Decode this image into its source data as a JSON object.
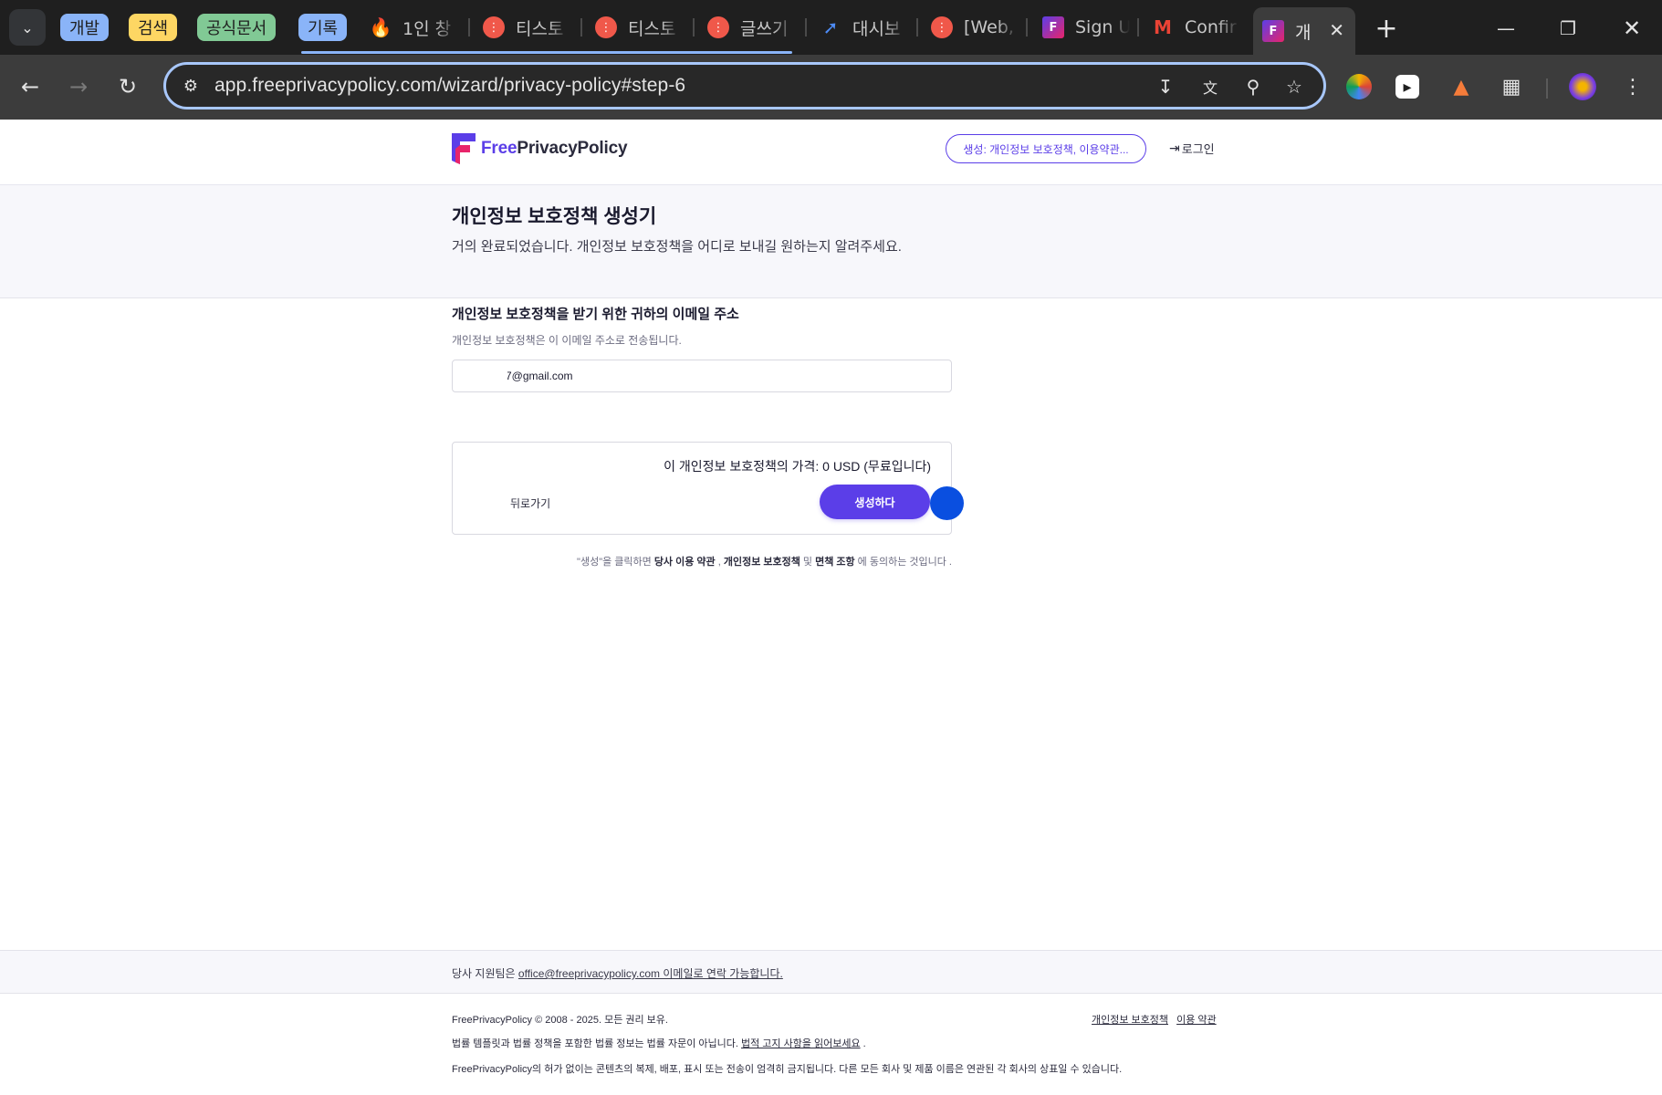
{
  "browser": {
    "tab_groups": [
      {
        "label": "개발",
        "color": "#8ab4f8"
      },
      {
        "label": "검색",
        "color": "#fdd663"
      },
      {
        "label": "공식문서",
        "color": "#81c995"
      },
      {
        "label": "기록",
        "color": "#8ab4f8"
      }
    ],
    "tabs": [
      {
        "label": "1인 창",
        "icon": "fire-icon"
      },
      {
        "label": "티스토",
        "icon": "tistory-icon"
      },
      {
        "label": "티스토",
        "icon": "tistory-icon"
      },
      {
        "label": "글쓰기",
        "icon": "tistory-icon"
      },
      {
        "label": "대시보",
        "icon": "dashboard-icon"
      },
      {
        "label": "[Web,",
        "icon": "tistory-icon"
      },
      {
        "label": "Sign U",
        "icon": "freeprivacypolicy-icon"
      },
      {
        "label": "Confir",
        "icon": "gmail-icon"
      }
    ],
    "active_tab": {
      "label": "개",
      "icon": "freeprivacypolicy-icon"
    },
    "url": "app.freeprivacypolicy.com/wizard/privacy-policy#step-6",
    "accent": "#a8c7fa"
  },
  "site": {
    "logo_free": "Free",
    "logo_rest": "PrivacyPolicy",
    "header_pill": "생성: 개인정보 보호정책, 이용약관...",
    "login": "로그인",
    "brand_color": "#5b3ee8"
  },
  "hero": {
    "title": "개인정보 보호정책 생성기",
    "subtitle": "거의 완료되었습니다. 개인정보 보호정책을 어디로 보내길 원하는지 알려주세요."
  },
  "form": {
    "email_label": "개인정보 보호정책을 받기 위한 귀하의 이메일 주소",
    "email_help": "개인정보 보호정책은 이 이메일 주소로 전송됩니다.",
    "email_value": "7@gmail.com"
  },
  "price": {
    "text": "이 개인정보 보호정책의 가격: 0 USD (무료입니다)",
    "back": "뒤로가기",
    "generate": "생성하다"
  },
  "terms": {
    "prefix": "\"생성\"을 클릭하면 ",
    "tos": "당사 이용 약관",
    "comma": " , ",
    "privacy": "개인정보 보호정책",
    "and": " 및 ",
    "disclaimer": "면책 조항",
    "suffix": " 에 동의하는 것입니다 ."
  },
  "support": {
    "prefix": "당사 지원팀은 ",
    "link": "office@freeprivacypolicy.com 이메일로 연락 가능합니다."
  },
  "footer": {
    "copyright": "FreePrivacyPolicy © 2008 - 2025. 모든 권리 보유.",
    "link_privacy": "개인정보 보호정책",
    "link_terms": "이용 약관",
    "legal_prefix": "법률 템플릿과 법률 정책을 포함한 법률 정보는 법률 자문이 아닙니다. ",
    "legal_link": "법적 고지 사항을 읽어보세요",
    "legal_suffix": " .",
    "rights": "FreePrivacyPolicy의 허가 없이는 콘텐츠의 복제, 배포, 표시 또는 전송이 엄격히 금지됩니다. 다른 모든 회사 및 제품 이름은 연관된 각 회사의 상표일 수 있습니다."
  }
}
